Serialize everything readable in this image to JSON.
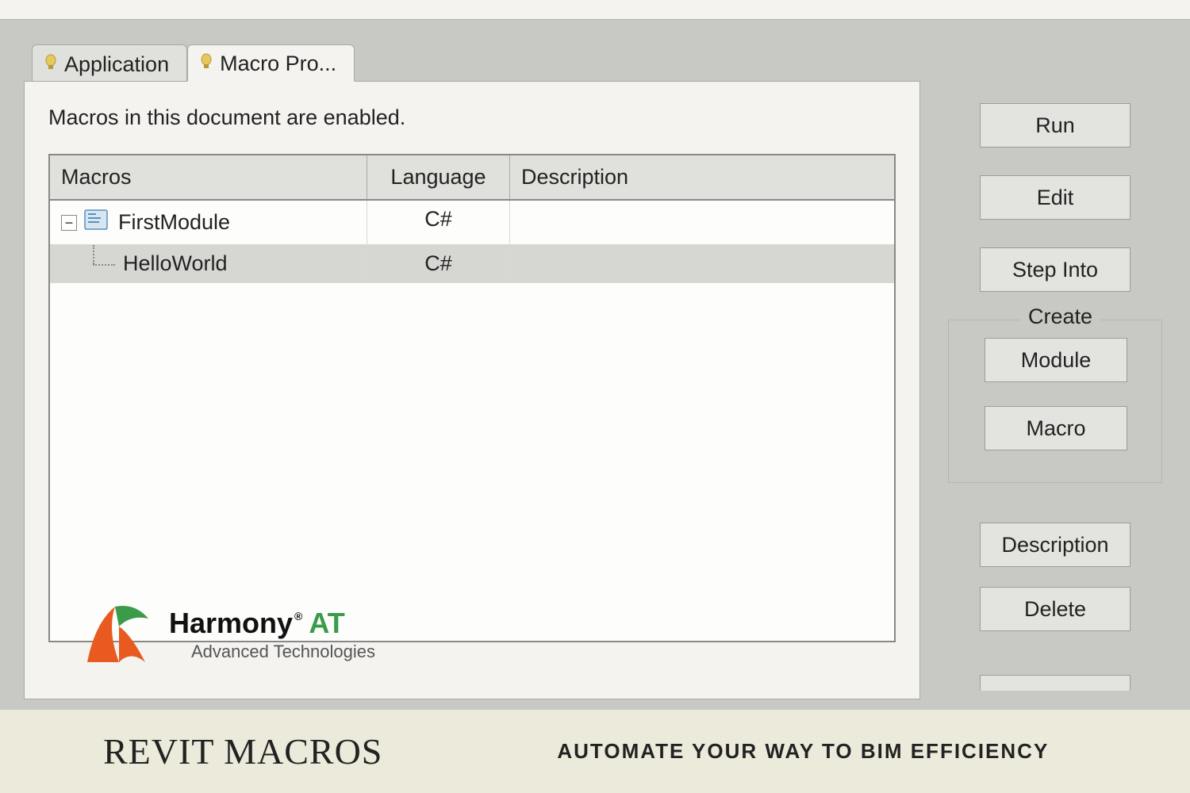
{
  "tabs": {
    "application": "Application",
    "macro_project": "Macro Pro..."
  },
  "panel": {
    "status": "Macros in this document are enabled.",
    "columns": {
      "macros": "Macros",
      "language": "Language",
      "description": "Description"
    },
    "rows": [
      {
        "name": "FirstModule",
        "language": "C#",
        "description": "",
        "type": "module"
      },
      {
        "name": "HelloWorld",
        "language": "C#",
        "description": "",
        "type": "macro"
      }
    ]
  },
  "buttons": {
    "run": "Run",
    "edit": "Edit",
    "step_into": "Step Into",
    "create_label": "Create",
    "module": "Module",
    "macro": "Macro",
    "description": "Description",
    "delete": "Delete"
  },
  "logo": {
    "brand": "Harmony",
    "reg": "®",
    "suffix": "AT",
    "tagline": "Advanced Technologies"
  },
  "footer": {
    "title": "REVIT MACROS",
    "subtitle": "AUTOMATE YOUR WAY TO BIM EFFICIENCY"
  }
}
